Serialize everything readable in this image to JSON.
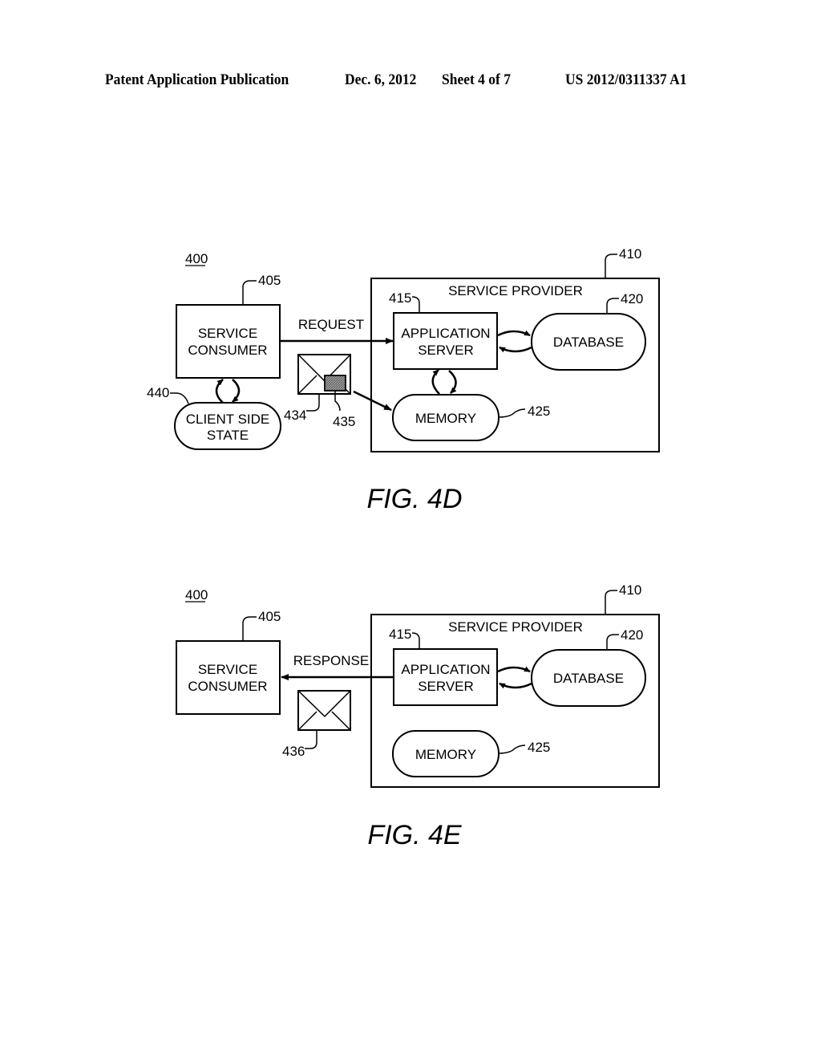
{
  "header": {
    "publication": "Patent Application Publication",
    "date": "Dec. 6, 2012",
    "sheet": "Sheet 4 of 7",
    "patent_number": "US 2012/0311337 A1"
  },
  "figures": [
    {
      "id": "4D",
      "caption": "FIG.  4D",
      "system_ref": "400",
      "service_consumer": {
        "ref": "405",
        "line1": "SERVICE",
        "line2": "CONSUMER"
      },
      "service_provider": {
        "ref": "410",
        "label": "SERVICE  PROVIDER"
      },
      "application_server": {
        "ref": "415",
        "line1": "APPLICATION",
        "line2": "SERVER"
      },
      "database": {
        "ref": "420",
        "label": "DATABASE"
      },
      "memory": {
        "ref": "425",
        "label": "MEMORY"
      },
      "client_side_state": {
        "ref": "440",
        "line1": "CLIENT  SIDE",
        "line2": "STATE"
      },
      "arrow_label": "REQUEST",
      "message": {
        "ref": "434",
        "attachment_ref": "435"
      }
    },
    {
      "id": "4E",
      "caption": "FIG.  4E",
      "system_ref": "400",
      "service_consumer": {
        "ref": "405",
        "line1": "SERVICE",
        "line2": "CONSUMER"
      },
      "service_provider": {
        "ref": "410",
        "label": "SERVICE  PROVIDER"
      },
      "application_server": {
        "ref": "415",
        "line1": "APPLICATION",
        "line2": "SERVER"
      },
      "database": {
        "ref": "420",
        "label": "DATABASE"
      },
      "memory": {
        "ref": "425",
        "label": "MEMORY"
      },
      "arrow_label": "RESPONSE",
      "message": {
        "ref": "436"
      }
    }
  ]
}
